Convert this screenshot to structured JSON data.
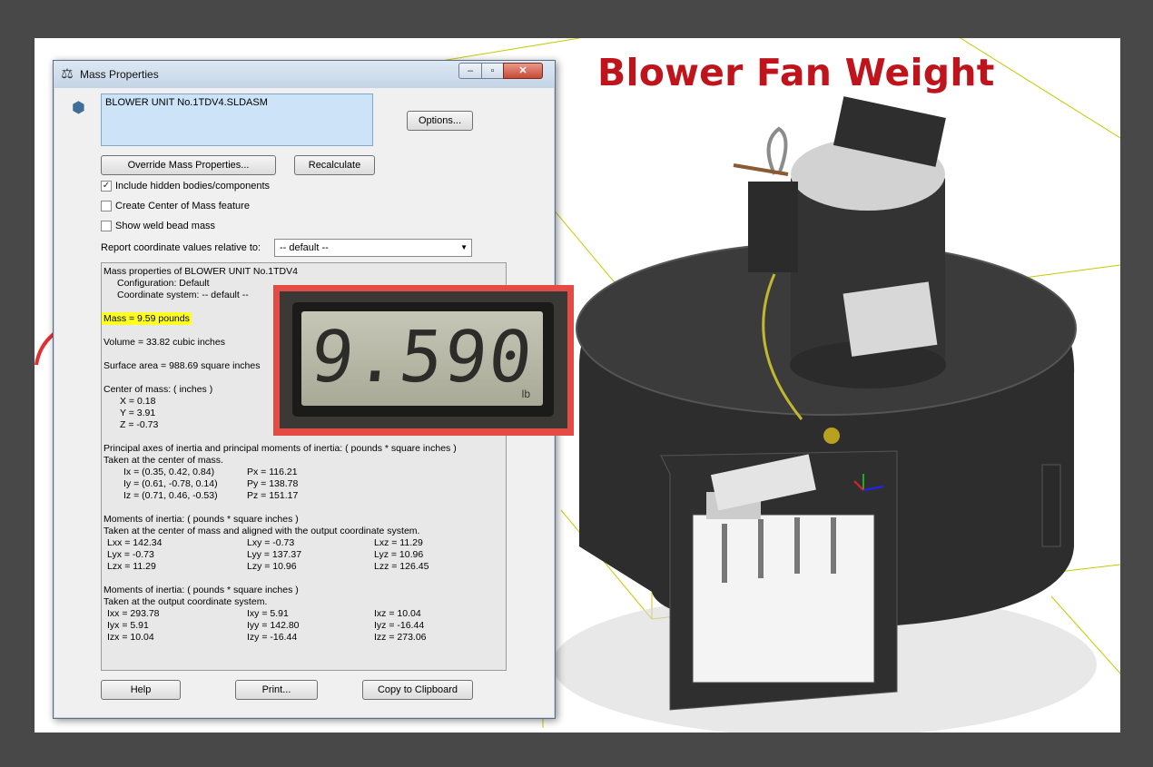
{
  "headline": "Blower Fan Weight",
  "dialog": {
    "title": "Mass Properties",
    "title_icon": "scale-icon",
    "assembly_icon": "assembly-icon",
    "filename": "BLOWER UNIT No.1TDV4.SLDASM",
    "buttons": {
      "options": "Options...",
      "override": "Override Mass Properties...",
      "recalculate": "Recalculate",
      "help": "Help",
      "print": "Print...",
      "copy": "Copy to Clipboard"
    },
    "checkboxes": [
      {
        "label": "Include hidden bodies/components",
        "checked": true
      },
      {
        "label": "Create Center of Mass feature",
        "checked": false
      },
      {
        "label": "Show weld bead mass",
        "checked": false
      }
    ],
    "coord_label": "Report coordinate values relative to:",
    "coord_value": "-- default --",
    "report": {
      "header": "Mass properties of BLOWER UNIT No.1TDV4",
      "configuration": "Configuration: Default",
      "coordinate_system": "Coordinate system: -- default --",
      "mass": "Mass = 9.59 pounds",
      "volume": "Volume = 33.82 cubic inches",
      "surface_area": "Surface area = 988.69 square inches",
      "com_header": "Center of mass: ( inches )",
      "com": [
        "X = 0.18",
        "Y = 3.91",
        "Z = -0.73"
      ],
      "principal_header": "Principal axes of inertia and principal moments of inertia: ( pounds * square inches )",
      "principal_sub": "Taken at the center of mass.",
      "principal_axes": [
        {
          "axis": "Ix = (0.35,  0.42,  0.84)",
          "moment": "Px = 116.21"
        },
        {
          "axis": "Iy = (0.61, -0.78,  0.14)",
          "moment": "Py = 138.78"
        },
        {
          "axis": "Iz = (0.71,  0.46, -0.53)",
          "moment": "Pz = 151.17"
        }
      ],
      "moi_com_header": "Moments of inertia: ( pounds * square inches )",
      "moi_com_sub": "Taken at the center of mass and aligned with the output coordinate system.",
      "moi_com": [
        [
          "Lxx = 142.34",
          "Lxy = -0.73",
          "Lxz = 11.29"
        ],
        [
          "Lyx = -0.73",
          "Lyy = 137.37",
          "Lyz = 10.96"
        ],
        [
          "Lzx = 11.29",
          "Lzy = 10.96",
          "Lzz = 126.45"
        ]
      ],
      "moi_out_header": "Moments of inertia: ( pounds * square inches )",
      "moi_out_sub": "Taken at the output coordinate system.",
      "moi_out": [
        [
          "Ixx = 293.78",
          "Ixy = 5.91",
          "Ixz = 10.04"
        ],
        [
          "Iyx = 5.91",
          "Iyy = 142.80",
          "Iyz = -16.44"
        ],
        [
          "Izx = 10.04",
          "Izy = -16.44",
          "Izz = 273.06"
        ]
      ]
    }
  },
  "scale": {
    "reading": "9.590",
    "unit": "lb"
  },
  "colors": {
    "headline": "#c0141c",
    "highlight": "#ffff20",
    "photo_frame": "#e34b44",
    "arrow": "#e03030"
  }
}
